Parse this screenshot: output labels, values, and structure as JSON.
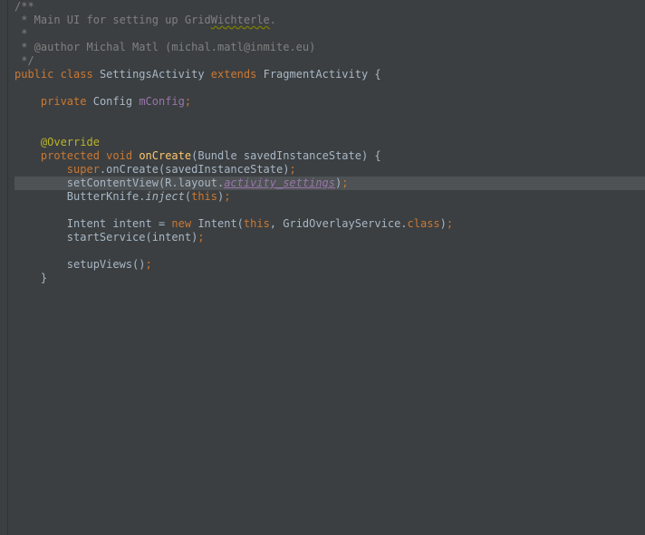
{
  "code": {
    "l0": "/**",
    "l1a": " * Main UI for setting up Grid",
    "l1b": "Wichterle",
    "l1c": ".",
    "l2": " *",
    "l3": " * @author Michal Matl (michal.matl@inmite.eu)",
    "l4": " */",
    "kw_public": "public",
    "kw_class": "class",
    "cls_SettingsActivity": "SettingsActivity",
    "kw_extends": "extends",
    "cls_FragmentActivity": "FragmentActivity",
    "brace_open": " {",
    "kw_private": "private",
    "cls_Config": "Config",
    "fld_mConfig": "mConfig",
    "semi": ";",
    "ann_override": "@Override",
    "kw_protected": "protected",
    "kw_void": "void",
    "m_onCreate": "onCreate",
    "param_open": "(",
    "cls_Bundle": "Bundle",
    "param_saved": " savedInstanceState",
    "param_close_brace": ") {",
    "kw_super": "super",
    "dot": ".",
    "call_onCreate": "onCreate(savedInstanceState)",
    "call_setContentView_a": "setContentView(R.layout.",
    "res_activity_settings": "activity_settings",
    "paren_close_semi": ");",
    "cls_ButterKnife": "ButterKnife",
    "m_inject": "inject",
    "kw_this": "this",
    "paren_open": "(",
    "cls_Intent": "Intent",
    "var_intent": " intent = ",
    "kw_new": "new",
    "cls_Intent2": " Intent(",
    "comma_sp": ", ",
    "cls_GridOverlayService": "GridOverlayService",
    "kw_class_ref": "class",
    "call_startService": "startService(intent)",
    "call_setupViews": "setupViews()",
    "brace_close": "}"
  }
}
